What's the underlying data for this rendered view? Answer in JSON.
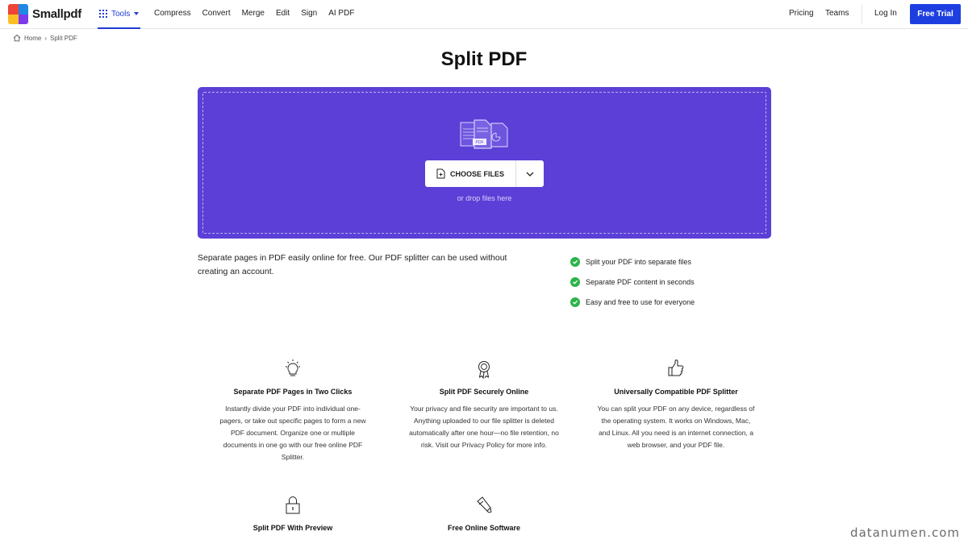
{
  "brand": {
    "name": "Smallpdf",
    "colors": [
      "#f0433a",
      "#1e88e5",
      "#fbbf24",
      "#7c3aed"
    ]
  },
  "header": {
    "tools_label": "Tools",
    "nav": [
      "Compress",
      "Convert",
      "Merge",
      "Edit",
      "Sign",
      "AI PDF"
    ],
    "pricing": "Pricing",
    "teams": "Teams",
    "login": "Log In",
    "trial": "Free Trial"
  },
  "breadcrumb": {
    "home": "Home",
    "current": "Split PDF"
  },
  "page_title": "Split PDF",
  "dropzone": {
    "button": "CHOOSE FILES",
    "hint": "or drop files here",
    "illustration_label": "PDF",
    "color": "#5b3fd6"
  },
  "intro": "Separate pages in PDF easily online for free. Our PDF splitter can be used without creating an account.",
  "checks": [
    "Split your PDF into separate files",
    "Separate PDF content in seconds",
    "Easy and free to use for everyone"
  ],
  "features": [
    {
      "icon": "lightbulb-icon",
      "title": "Separate PDF Pages in Two Clicks",
      "text": "Instantly divide your PDF into individual one-pagers, or take out specific pages to form a new PDF document. Organize one or multiple documents in one go with our free online PDF Splitter."
    },
    {
      "icon": "badge-icon",
      "title": "Split PDF Securely Online",
      "text": "Your privacy and file security are important to us. Anything uploaded to our file splitter is deleted automatically after one hour—no file retention, no risk. Visit our Privacy Policy for more info."
    },
    {
      "icon": "thumbs-up-icon",
      "title": "Universally Compatible PDF Splitter",
      "text": "You can split your PDF on any device, regardless of the operating system. It works on Windows, Mac, and Linux. All you need is an internet connection, a web browser, and your PDF file."
    },
    {
      "icon": "lock-icon",
      "title": "Split PDF With Preview",
      "text": ""
    },
    {
      "icon": "magic-wand-icon",
      "title": "Free Online Software",
      "text": ""
    }
  ],
  "watermark": "datanumen.com"
}
